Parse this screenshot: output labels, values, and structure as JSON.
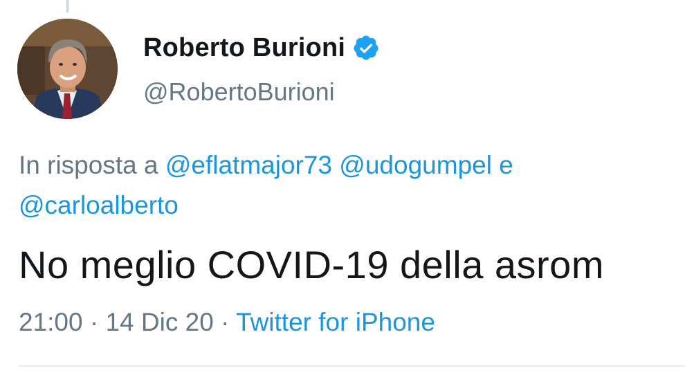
{
  "author": {
    "display_name": "Roberto Burioni",
    "handle": "@RobertoBurioni",
    "verified": true,
    "avatar_icon": "profile-photo"
  },
  "reply": {
    "prefix": "In risposta a",
    "mentions": [
      "@eflatmajor73",
      "@udogumpel",
      "@carloalberto"
    ],
    "conjunction": "e"
  },
  "tweet": {
    "text": "No meglio COVID-19 della asrom"
  },
  "meta": {
    "time": "21:00",
    "date": "14 Dic 20",
    "separator": "·",
    "source": "Twitter for iPhone"
  },
  "colors": {
    "link": "#1b95e0",
    "secondary_text": "#657786",
    "primary_text": "#14171a",
    "verified_badge": "#1da1f2"
  }
}
